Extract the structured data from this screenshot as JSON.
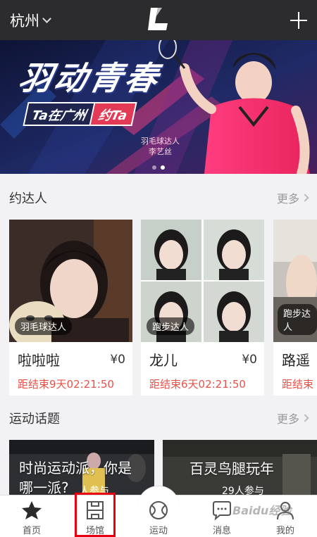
{
  "header": {
    "city": "杭州",
    "icons": {
      "city_dropdown": "chevron-down-icon",
      "logo": "app-logo",
      "add": "plus-icon"
    }
  },
  "banner": {
    "title": "羽动青春",
    "subtitle_part1": "Ta在广州",
    "subtitle_part2": "约Ta",
    "caption_line1": "羽毛球达人",
    "caption_line2": "李艺丝",
    "pages": 2,
    "active_page": 2
  },
  "meet_section": {
    "title": "约达人",
    "more": "更多"
  },
  "people": [
    {
      "tag": "羽毛球达人",
      "name": "啦啦啦",
      "price": "¥0",
      "timer": "距结束9天02:21:50"
    },
    {
      "tag": "跑步达人",
      "name": "龙儿",
      "price": "¥0",
      "timer": "距结束6天02:21:50"
    },
    {
      "tag": "跑步达人",
      "name": "路遥",
      "price": "",
      "timer": "距结束"
    }
  ],
  "topics_section": {
    "title": "运动话题",
    "more": "更多"
  },
  "topics": [
    {
      "title_line1": "时尚运动派，你是",
      "title_line2": "哪一派?",
      "count": "人参与"
    },
    {
      "title_line1": "百灵鸟腿玩年",
      "count": "29人参与"
    }
  ],
  "tabbar": {
    "tabs": [
      {
        "label": "首页",
        "icon": "star-icon"
      },
      {
        "label": "场馆",
        "icon": "venue-icon"
      },
      {
        "label": "运动",
        "icon": "ball-icon"
      },
      {
        "label": "消息",
        "icon": "chat-bubble-icon"
      },
      {
        "label": "我的",
        "icon": "person-icon"
      }
    ]
  },
  "watermark": "Baidu经验",
  "colors": {
    "topbar": "#2c2c2e",
    "accent_red": "#e8524a",
    "highlight_box": "#e60012",
    "banner_pink": "#e33a55"
  }
}
